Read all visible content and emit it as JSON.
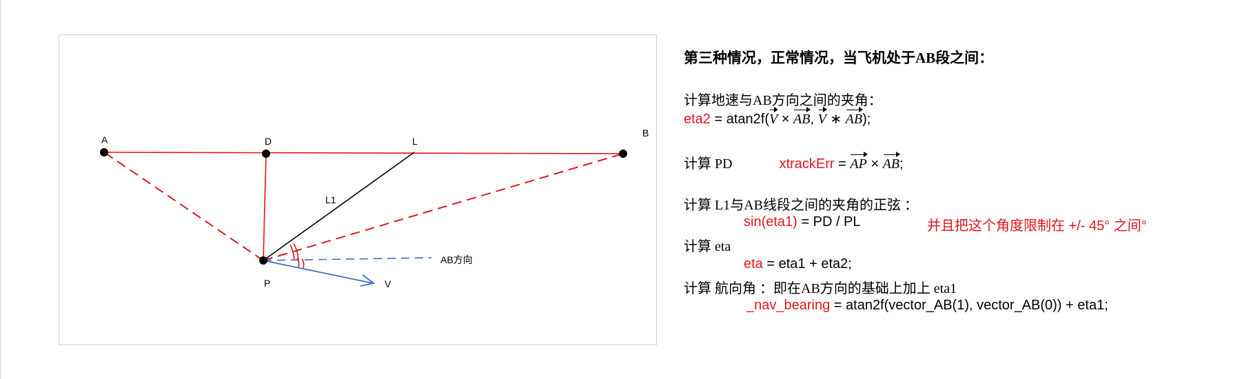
{
  "figure": {
    "labels": {
      "A": "A",
      "B": "B",
      "D": "D",
      "L": "L",
      "P": "P",
      "L1": "L1",
      "V": "V",
      "ab_dir": "AB方向"
    }
  },
  "notes": {
    "title": "第三种情况，正常情况，当飞机处于AB段之间：",
    "s1_head": "计算地速与AB方向之间的夹角：",
    "s1_var": "eta2",
    "s1_eq": " = atan2f(",
    "s1_v1": "V",
    "s1_times": " × ",
    "s1_ab1": "AB",
    "s1_comma": ", ",
    "s1_v2": "V",
    "s1_star": " ∗ ",
    "s1_ab2": "AB",
    "s1_end": ");",
    "s2_head": "计算 PD",
    "s2_var": "xtrackErr",
    "s2_eq": " = ",
    "s2_ap": "AP",
    "s2_times": " × ",
    "s2_ab": "AB",
    "s2_end": ";",
    "s3_head": "计算 L1与AB线段之间的夹角的正弦 ：",
    "s3_var": "sin(eta1)",
    "s3_eq": " = PD / PL",
    "s3_note": "并且把这个角度限制在 +/- 45° 之间°",
    "s4_head": "计算 eta",
    "s4_var": "eta",
    "s4_eq": " = eta1 + eta2;",
    "s5_head": "计算 航向角 ：即在AB方向的基础上加上 eta1",
    "s5_var": "_nav_bearing",
    "s5_eq": " = atan2f(vector_AB(1), vector_AB(0)) + eta1;"
  },
  "colors": {
    "red": "#e0141e",
    "blue": "#3d6bc2",
    "black": "#000000"
  }
}
